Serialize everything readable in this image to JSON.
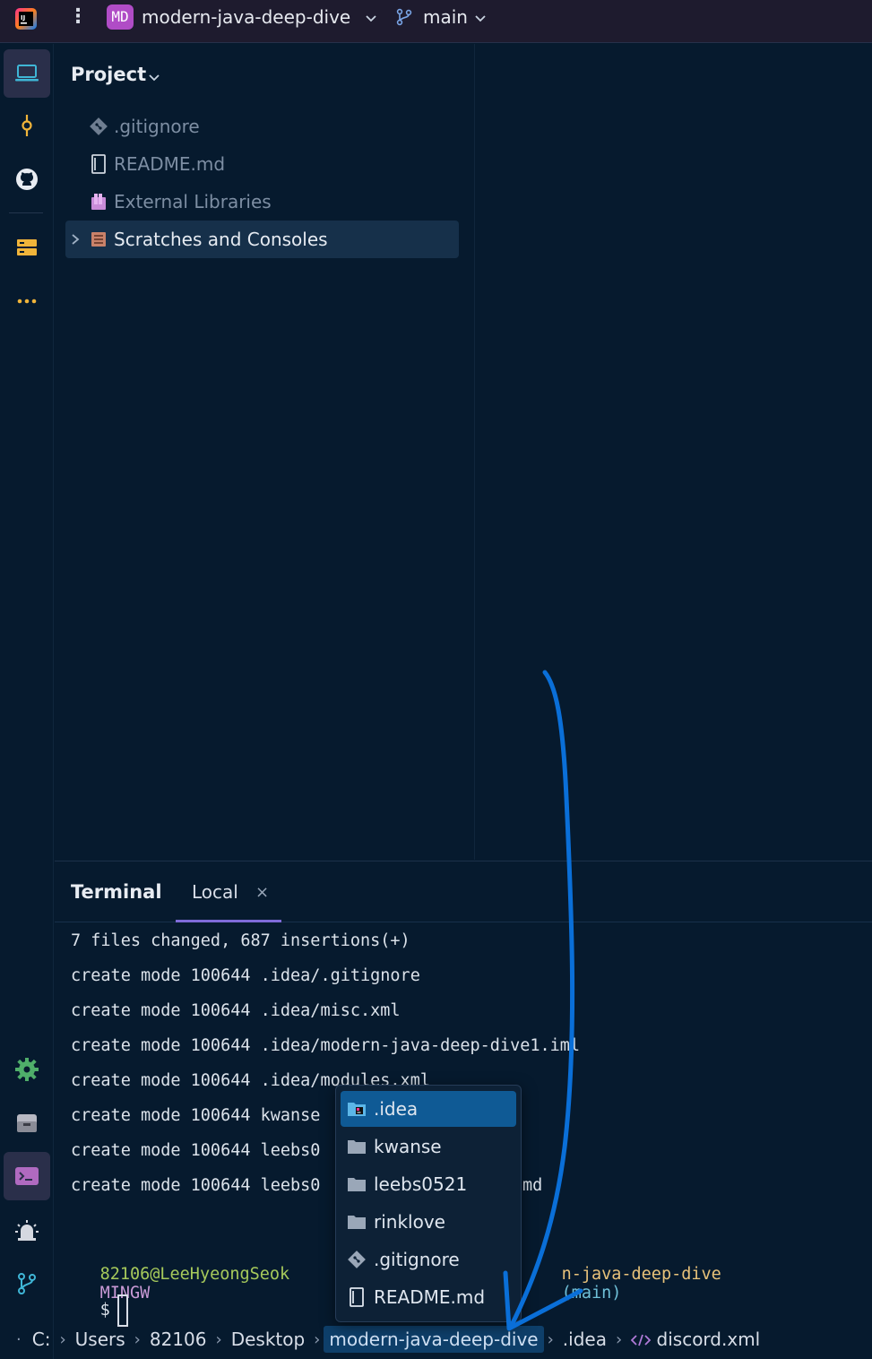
{
  "titlebar": {
    "project_badge": "MD",
    "project_name": "modern-java-deep-dive",
    "branch": "main"
  },
  "project_panel": {
    "title": "Project",
    "items": [
      {
        "label": ".gitignore",
        "icon": "git-diamond-icon",
        "style": "muted"
      },
      {
        "label": "README.md",
        "icon": "markdown-file-icon",
        "style": "muted"
      },
      {
        "label": "External Libraries",
        "icon": "library-icon",
        "style": "muted"
      },
      {
        "label": "Scratches and Consoles",
        "icon": "scratches-icon",
        "style": "bright",
        "selected": true
      }
    ]
  },
  "terminal": {
    "title": "Terminal",
    "tab_label": "Local",
    "lines": [
      "7 files changed, 687 insertions(+)",
      "create mode 100644 .idea/.gitignore",
      "create mode 100644 .idea/misc.xml",
      "create mode 100644 .idea/modern-java-deep-dive1.iml",
      "create mode 100644 .idea/modules.xml",
      "create mode 100644 kwanse",
      "create mode 100644 leebs0",
      "create mode 100644 leebs0",
      ""
    ],
    "line_tail": "md",
    "prompt": {
      "user": "82106@LeeHyeongSeok",
      "system": "MINGW",
      "path": "n-java-deep-dive",
      "branch": "(main)"
    },
    "dollar": "$"
  },
  "popup": {
    "items": [
      {
        "label": ".idea",
        "icon": "idea-folder-icon",
        "selected": true
      },
      {
        "label": "kwanse",
        "icon": "folder-icon"
      },
      {
        "label": "leebs0521",
        "icon": "folder-icon"
      },
      {
        "label": "rinklove",
        "icon": "folder-icon"
      },
      {
        "label": ".gitignore",
        "icon": "git-diamond-icon"
      },
      {
        "label": "README.md",
        "icon": "markdown-file-icon"
      }
    ]
  },
  "breadcrumb": {
    "items": [
      "C:",
      "Users",
      "82106",
      "Desktop",
      "modern-java-deep-dive",
      ".idea",
      "discord.xml"
    ],
    "highlighted_index": 4,
    "last_icon": "xml-file-icon"
  },
  "colors": {
    "accent": "#7f6bd9",
    "annotation_arrow": "#0a6fd8",
    "selection": "#0f5a95"
  }
}
